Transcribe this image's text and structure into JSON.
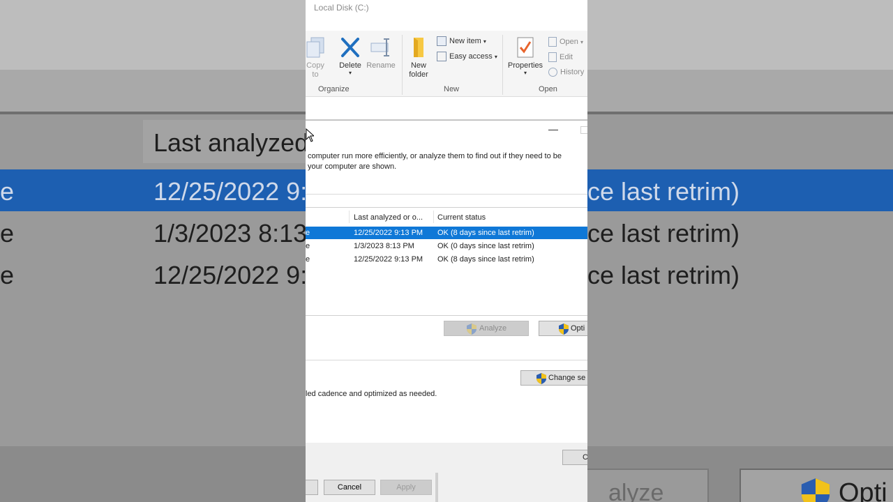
{
  "background": {
    "header_text": "Last analyzed",
    "rows": [
      {
        "prefix": "e",
        "date": "12/25/2022 9:",
        "status": "ce last retrim)"
      },
      {
        "prefix": "e",
        "date": "1/3/2023 8:13",
        "status": "ce last retrim)"
      },
      {
        "prefix": "e",
        "date": "12/25/2022 9:",
        "status": "ce last retrim)"
      }
    ],
    "bottom_buttons": [
      "alyze",
      "Opti"
    ]
  },
  "explorer": {
    "title": "Local Disk (C:)",
    "organize": {
      "label": "Organize",
      "copy_to": "Copy to",
      "delete": "Delete",
      "rename": "Rename"
    },
    "new": {
      "label": "New",
      "new_folder": "New folder",
      "new_item": "New item",
      "easy_access": "Easy access"
    },
    "open": {
      "label": "Open",
      "properties": "Properties",
      "open": "Open",
      "edit": "Edit",
      "history": "History"
    }
  },
  "dialog": {
    "description_line1": "computer run more efficiently, or analyze them to find out if they need to be",
    "description_line2": "your computer are shown.",
    "columns": [
      "Last analyzed or o...",
      "Current status"
    ],
    "drives": [
      {
        "prefix": "e",
        "last_analyzed": "12/25/2022 9:13 PM",
        "status": "OK (8 days since last retrim)",
        "selected": true
      },
      {
        "prefix": "e",
        "last_analyzed": "1/3/2023 8:13 PM",
        "status": "OK (0 days since last retrim)",
        "selected": false
      },
      {
        "prefix": "e",
        "last_analyzed": "12/25/2022 9:13 PM",
        "status": "OK (8 days since last retrim)",
        "selected": false
      }
    ],
    "analyze_button": "Analyze",
    "optimize_button": "Opti",
    "change_settings_button": "Change se",
    "scheduled_text": "led cadence and optimized as needed.",
    "close_button": "C"
  },
  "properties_footer": {
    "cancel": "Cancel",
    "apply": "Apply"
  },
  "colors": {
    "selection": "#0f78d7",
    "ribbon_bg": "#f5f5f5",
    "delete_icon": "#1f6fbf",
    "properties_check": "#e8642c"
  }
}
